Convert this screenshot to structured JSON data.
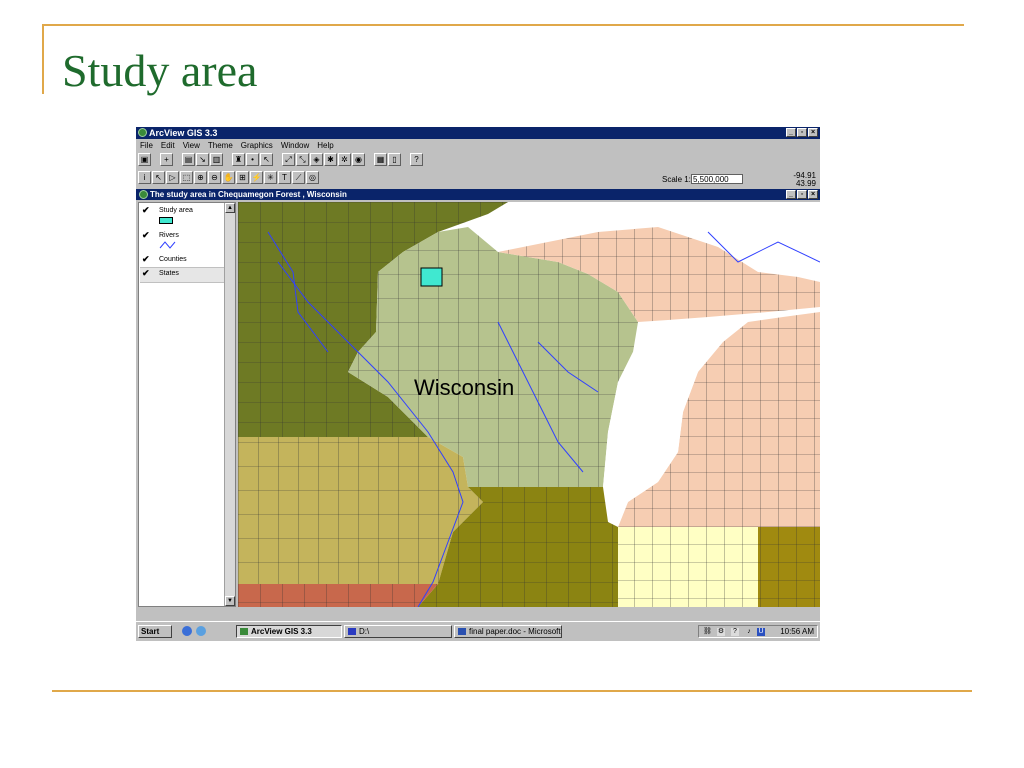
{
  "slide": {
    "title": "Study area"
  },
  "window": {
    "title": "ArcView GIS 3.3",
    "menu": [
      "File",
      "Edit",
      "View",
      "Theme",
      "Graphics",
      "Window",
      "Help"
    ],
    "scale_label": "Scale 1:",
    "scale_value": "5,500,000",
    "coord_x": "-94.91",
    "coord_y": "43.99"
  },
  "view": {
    "title": "The study area in Chequamegon Forest , Wisconsin",
    "legend": [
      {
        "label": "Study area",
        "checked": true,
        "symbol": "box",
        "color": "#40e8d0"
      },
      {
        "label": "Rivers",
        "checked": true,
        "symbol": "line",
        "color": "#3040ff"
      },
      {
        "label": "Counties",
        "checked": true,
        "symbol": "none"
      },
      {
        "label": "States",
        "checked": true,
        "symbol": "none"
      }
    ],
    "map_label": "Wisconsin"
  },
  "taskbar": {
    "start": "Start",
    "tasks": [
      "ArcView GIS 3.3",
      "D:\\",
      "final paper.doc - Microsoft..."
    ],
    "clock": "10:56 AM"
  },
  "colors": {
    "minnesota": "#6e7a24",
    "wisconsin": "#b6c38e",
    "iowa": "#c4b45c",
    "illinois": "#8b8412",
    "michigan": "#f6cdb2",
    "indiana": "#ffffc4",
    "ohio": "#a08a10",
    "missouri": "#c8684c",
    "water": "#ffffff",
    "rivers": "#3040ff",
    "study_area": "#40e8d0"
  },
  "icons": [
    "info-icon",
    "pointer-icon",
    "vertex-icon",
    "zoom-extent-icon",
    "zoom-in-icon",
    "zoom-out-icon",
    "pan-icon",
    "measure-icon",
    "hotlink-icon",
    "label-icon",
    "text-icon",
    "draw-icon",
    "zoom-tool-icon"
  ]
}
